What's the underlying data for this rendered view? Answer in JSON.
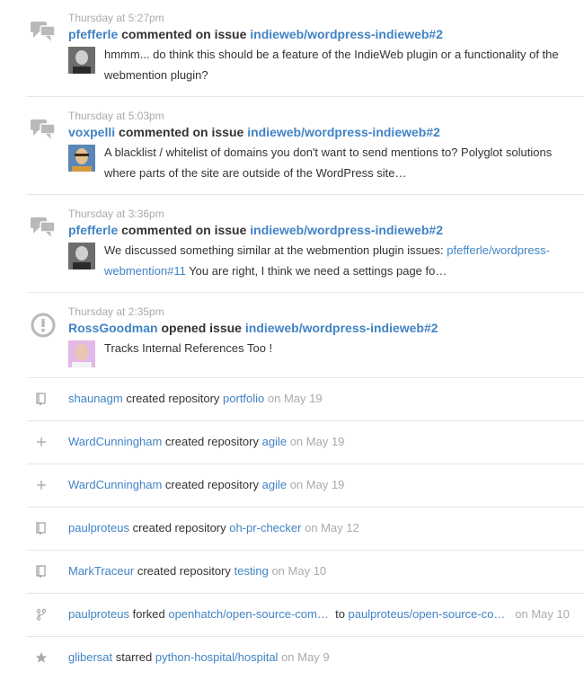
{
  "events": [
    {
      "time": "Thursday at 5:27pm",
      "user": "pfefferle",
      "action": "commented on issue",
      "repo_issue": "indieweb/wordpress-indieweb#2",
      "body": "hmmm... do think this should be a feature of the IndieWeb plugin or a functionality of the webmention plugin?"
    },
    {
      "time": "Thursday at 5:03pm",
      "user": "voxpelli",
      "action": "commented on issue",
      "repo_issue": "indieweb/wordpress-indieweb#2",
      "body": "A blacklist / whitelist of domains you don't want to send mentions to? Polyglot solutions where parts of the site are outside of the WordPress site…"
    },
    {
      "time": "Thursday at 3:36pm",
      "user": "pfefferle",
      "action": "commented on issue",
      "repo_issue": "indieweb/wordpress-indieweb#2",
      "body_pre": "We discussed something similar at the webmention plugin issues: ",
      "body_link": "pfefferle/wordpress-webmention#11",
      "body_post": " You are right, I think we need a settings page fo…"
    },
    {
      "time": "Thursday at 2:35pm",
      "user": "RossGoodman",
      "action": "opened issue",
      "repo_issue": "indieweb/wordpress-indieweb#2",
      "body": "Tracks Internal References Too !"
    }
  ],
  "simple": [
    {
      "icon": "repo-icon",
      "user": "shaunagm",
      "action": "created repository",
      "repo": "portfolio",
      "date": "on May 19"
    },
    {
      "icon": "plus-icon",
      "user": "WardCunningham",
      "action": "created repository",
      "repo": "agile",
      "date": "on May 19"
    },
    {
      "icon": "plus-icon",
      "user": "WardCunningham",
      "action": "created repository",
      "repo": "agile",
      "date": "on May 19"
    },
    {
      "icon": "repo-icon",
      "user": "paulproteus",
      "action": "created repository",
      "repo": "oh-pr-checker",
      "date": "on May 12"
    },
    {
      "icon": "repo-icon",
      "user": "MarkTraceur",
      "action": "created repository",
      "repo": "testing",
      "date": "on May 10"
    },
    {
      "icon": "fork-icon",
      "user": "paulproteus",
      "action": "forked",
      "repo": "openhatch/open-source-com…",
      "to": "to",
      "repo2": "paulproteus/open-source-co…",
      "date": "on May 10"
    },
    {
      "icon": "star-icon",
      "user": "glibersat",
      "action": "starred",
      "repo": "python-hospital/hospital",
      "date": "on May 9"
    }
  ]
}
